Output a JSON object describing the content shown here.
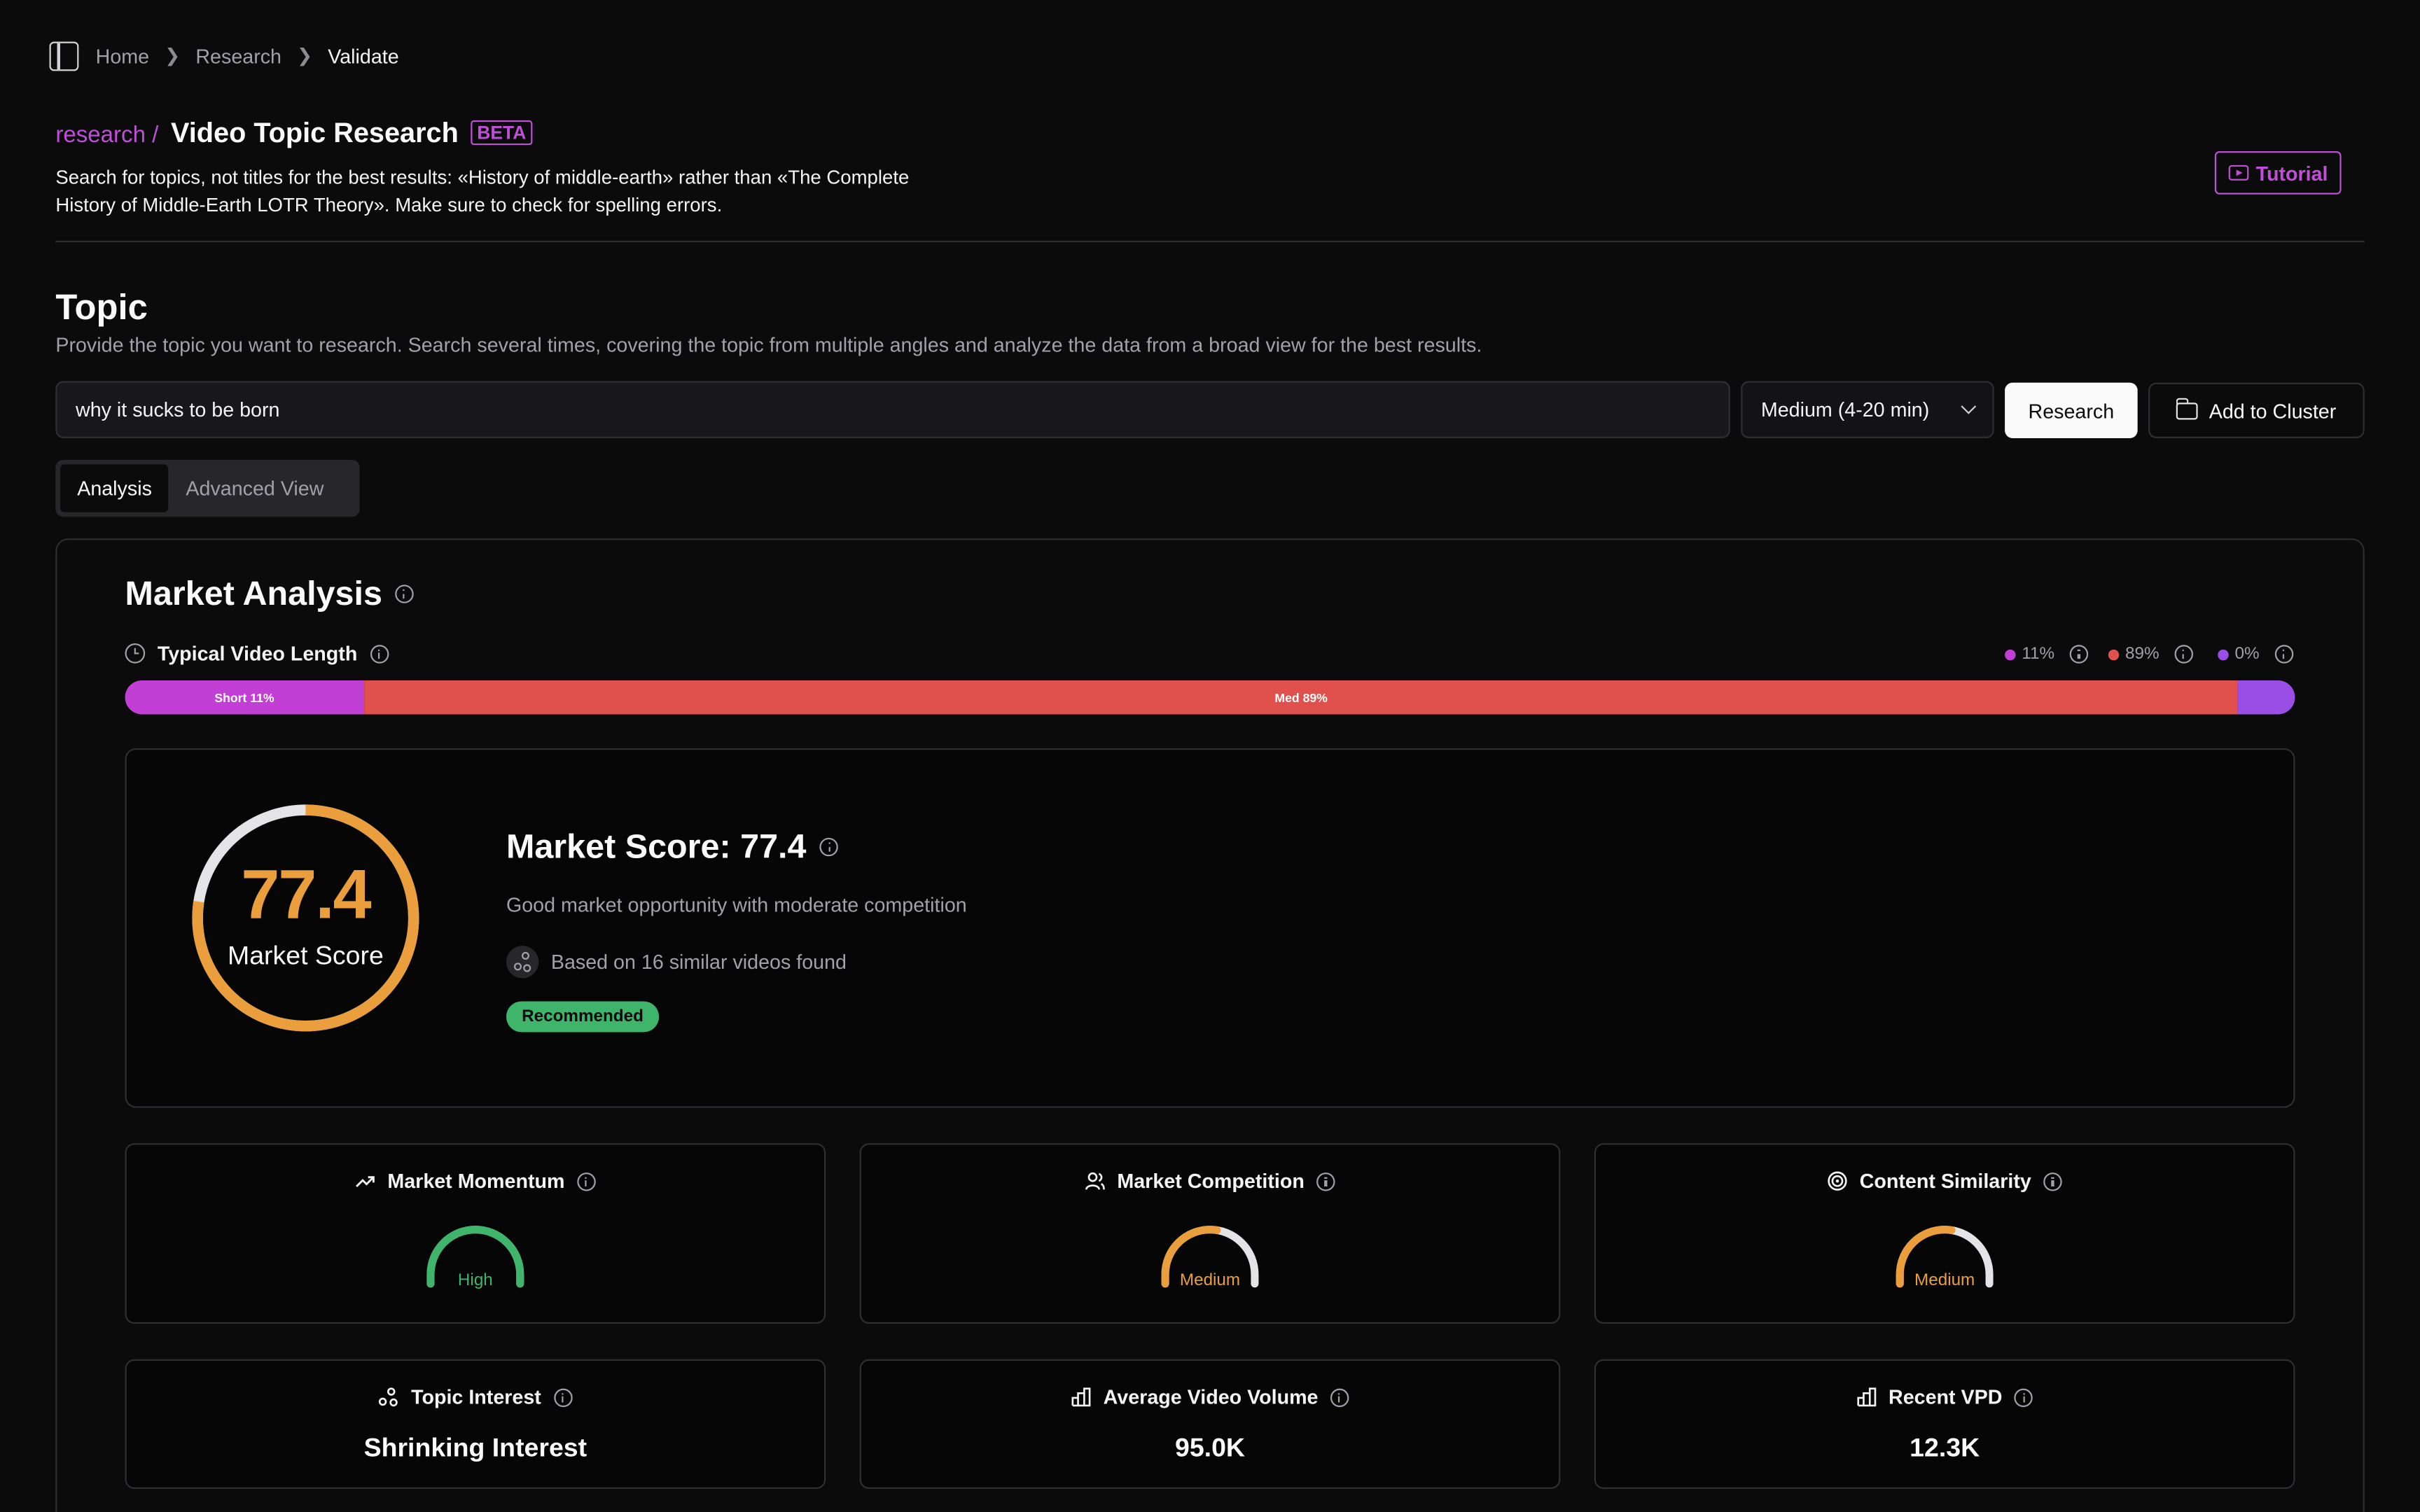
{
  "breadcrumb": {
    "items": [
      "Home",
      "Research",
      "Validate"
    ]
  },
  "header": {
    "slug": "research /",
    "title": "Video Topic Research",
    "badge": "BETA",
    "description_line1": "Search for topics, not titles for the best results: «History of middle-earth» rather than «The Complete",
    "description_line2": "History of Middle-Earth LOTR Theory». Make sure to check for spelling errors.",
    "tutorial_label": "Tutorial"
  },
  "topic": {
    "heading": "Topic",
    "description": "Provide the topic you want to research. Search several times, covering the topic from multiple angles and analyze the data from a broad view for the best results.",
    "input_value": "why it sucks to be born",
    "length_select": "Medium (4-20 min)",
    "research_button": "Research",
    "cluster_button": "Add to Cluster"
  },
  "tabs": [
    {
      "label": "Analysis",
      "active": true
    },
    {
      "label": "Advanced View",
      "active": false
    }
  ],
  "market_analysis": {
    "title": "Market Analysis",
    "video_length": {
      "label": "Typical Video Length",
      "legend": [
        {
          "value": "11%",
          "color": "#c23fd6"
        },
        {
          "value": "89%",
          "color": "#e0504c"
        },
        {
          "value": "0%",
          "color": "#9a4ee6"
        }
      ],
      "segments": [
        {
          "label": "Short 11%",
          "share": 0.11,
          "color": "#c23fd6"
        },
        {
          "label": "Med 89%",
          "share": 0.89,
          "color": "#e0504c"
        },
        {
          "label": "",
          "share": 0.0,
          "color": "#9a4ee6"
        }
      ]
    },
    "score": {
      "value": "77.4",
      "value_fraction": 0.774,
      "ring_label": "Market Score",
      "title": "Market Score: 77.4",
      "description": "Good market opportunity with moderate competition",
      "based_on": "Based on 16 similar videos found",
      "badge": "Recommended",
      "accent_color": "#eb9f3c",
      "badge_color": "#3fb56c"
    },
    "gauges": [
      {
        "title": "Market Momentum",
        "icon": "trending-up-icon",
        "level": "High",
        "fraction": 1.0,
        "color": "#3fb56c"
      },
      {
        "title": "Market Competition",
        "icon": "users-icon",
        "level": "Medium",
        "fraction": 0.55,
        "color": "#eb9f3c"
      },
      {
        "title": "Content Similarity",
        "icon": "target-icon",
        "level": "Medium",
        "fraction": 0.55,
        "color": "#eb9f3c"
      }
    ],
    "stats": [
      {
        "title": "Topic Interest",
        "icon": "nodes-icon",
        "value": "Shrinking Interest"
      },
      {
        "title": "Average Video Volume",
        "icon": "bar-chart-icon",
        "value": "95.0K"
      },
      {
        "title": "Recent VPD",
        "icon": "bar-chart-icon",
        "value": "12.3K"
      }
    ]
  }
}
